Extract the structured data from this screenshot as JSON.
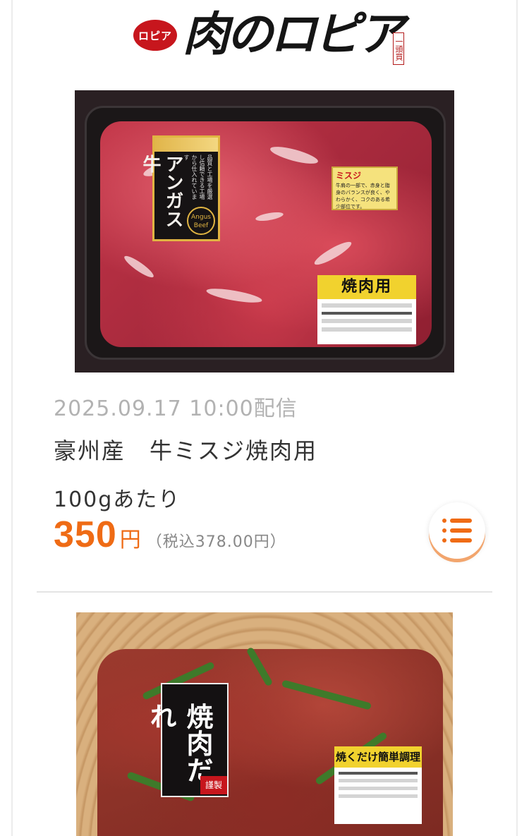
{
  "brand": {
    "logo_mark_text": "ロピア",
    "logo_name_text": "肉のロピア",
    "logo_seal_text": "一頭買"
  },
  "items": [
    {
      "photo": {
        "label_title": "アンガス牛",
        "label_note": "ロピアの",
        "label_sub": "品質と工場を厳選し信頼できる工場から仕入れています",
        "label_badge": "Angus Beef",
        "cut_label_head": "ミスジ",
        "cut_label_body": "牛肩の一部で、赤身と脂身のバランスが良く、やわらかく、コクのある希少部位です。",
        "sticker_head": "焼肉用",
        "sticker_line": "牛肩厚切り焼肉用豪州産(みすじ)"
      },
      "date": "2025.09.17 10:00配信",
      "title": "豪州産　牛ミスジ焼肉用",
      "unit": "100gあたり",
      "price": "350",
      "currency": "円",
      "tax_note": "（税込378.00円）"
    },
    {
      "photo": {
        "label_title": "焼肉だれ",
        "label_red": "謹製",
        "sticker_head": "焼くだけ簡単調理",
        "sticker_line": "国産豚ハラミ焼肉用味付・醤油"
      }
    }
  ],
  "colors": {
    "accent": "#ef6b15",
    "date_text": "#b2b2b2",
    "body_text": "#333333",
    "brand_red": "#c7161d"
  },
  "icons": {
    "menu_button": "list-icon"
  }
}
